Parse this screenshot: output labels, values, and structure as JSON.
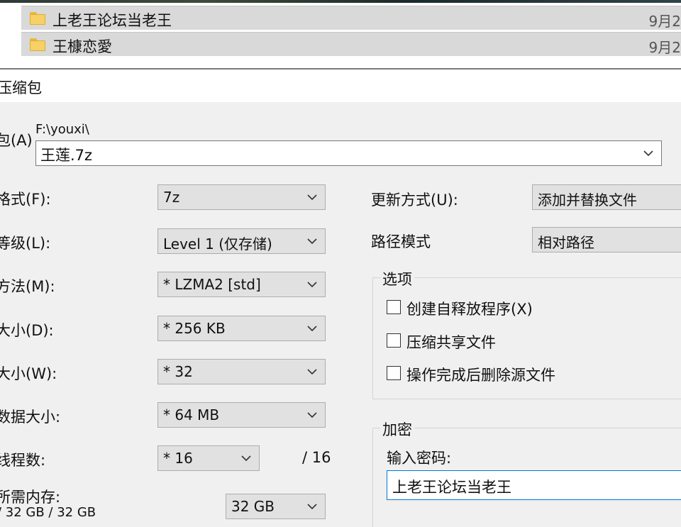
{
  "explorer": {
    "files": [
      {
        "name": "上老王论坛当老王",
        "date": "9月2",
        "icon": "folder-icon"
      },
      {
        "name": "王槺恋愛",
        "date": "9月2",
        "icon": "folder-icon"
      }
    ]
  },
  "dialog": {
    "title": "压缩包",
    "archive": {
      "label": "包(A)",
      "path": "F:\\youxi\\",
      "value": "王莲.7z"
    },
    "left_fields": [
      {
        "label": "格式(F):",
        "value": "7z"
      },
      {
        "label": "等级(L):",
        "value": "Level 1 (仅存储)"
      },
      {
        "label": "方法(M):",
        "value": "*  LZMA2 [std]"
      },
      {
        "label": "大小(D):",
        "value": "*  256 KB"
      },
      {
        "label": "大小(W):",
        "value": "*  32"
      },
      {
        "label": "数据大小:",
        "value": "*  64 MB"
      }
    ],
    "threads": {
      "label": "线程数:",
      "value": "*  16",
      "max": "/ 16"
    },
    "memory": {
      "label": "所需内存:",
      "values": "/ 32 GB / 32 GB",
      "value": "32 GB"
    },
    "update_mode": {
      "label": "更新方式(U):",
      "value": "添加并替换文件"
    },
    "path_mode": {
      "label": "路径模式",
      "value": "相对路径"
    },
    "options": {
      "title": "选项",
      "items": [
        {
          "label": "创建自释放程序(X)",
          "checked": false
        },
        {
          "label": "压缩共享文件",
          "checked": false
        },
        {
          "label": "操作完成后删除源文件",
          "checked": false
        }
      ]
    },
    "encryption": {
      "title": "加密",
      "password_label": "输入密码:",
      "password_value": "上老王论坛当老王"
    }
  },
  "colors": {
    "dialog_bg": "#f0f0f0",
    "combo_bg": "#e1e1e1",
    "folder": "#f7d066",
    "focus_border": "#0078d7"
  }
}
